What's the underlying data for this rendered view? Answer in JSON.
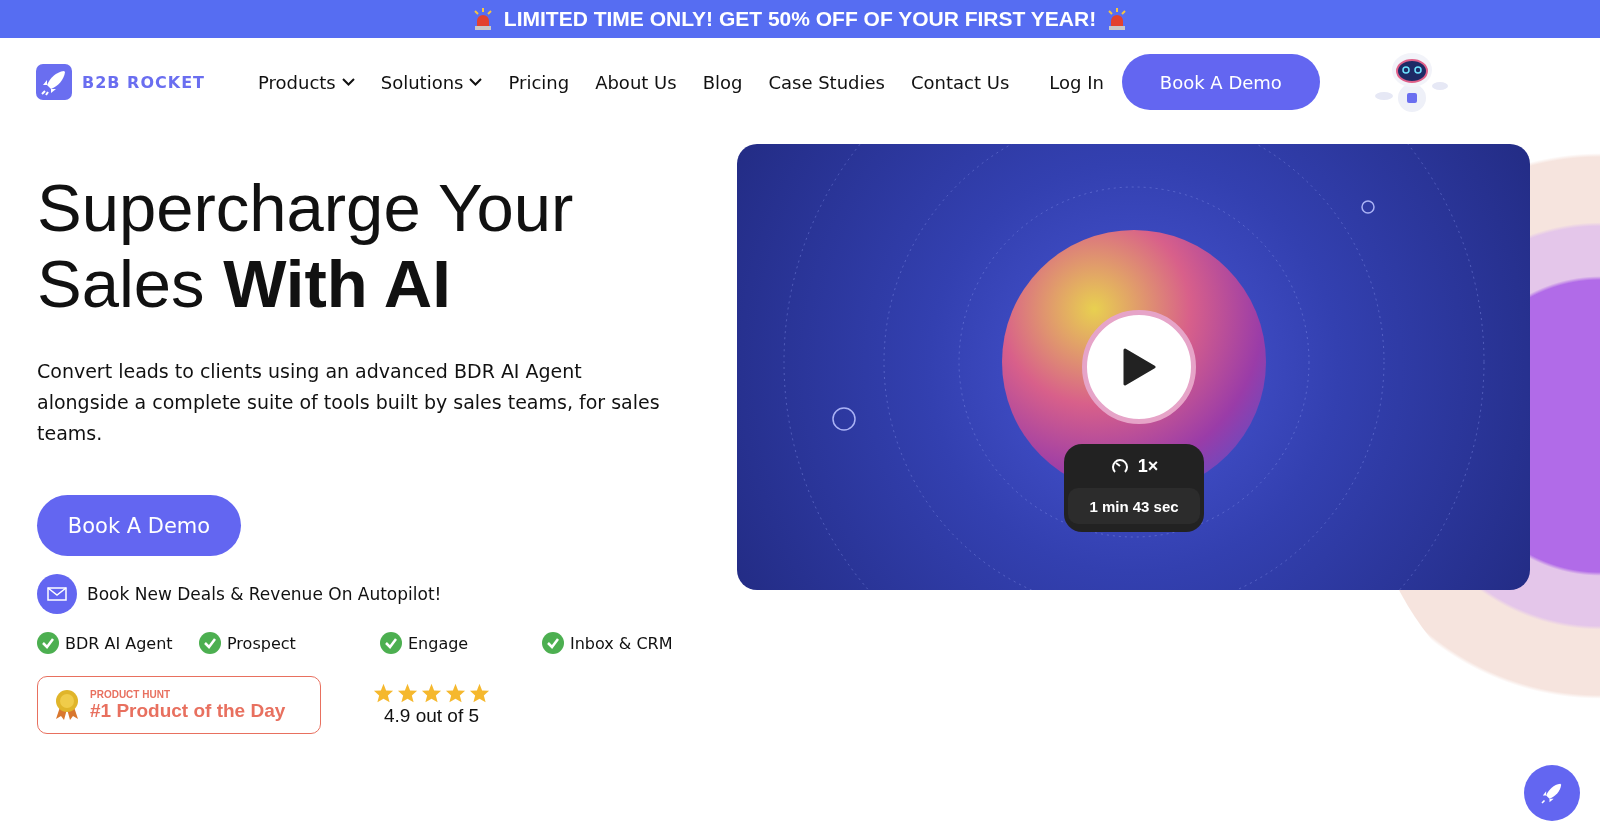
{
  "banner": {
    "text": "LIMITED TIME ONLY! GET 50% OFF OF YOUR FIRST YEAR!"
  },
  "nav": {
    "logo": "B2B ROCKET",
    "items": [
      {
        "label": "Products",
        "dropdown": true
      },
      {
        "label": "Solutions",
        "dropdown": true
      },
      {
        "label": "Pricing",
        "dropdown": false
      },
      {
        "label": "About Us",
        "dropdown": false
      },
      {
        "label": "Blog",
        "dropdown": false
      },
      {
        "label": "Case Studies",
        "dropdown": false
      },
      {
        "label": "Contact Us",
        "dropdown": false
      }
    ],
    "login": "Log In",
    "cta": "Book A Demo"
  },
  "hero": {
    "title": "Supercharge Your Sales **With AI**",
    "subtitle": "Convert leads to clients using an advanced BDR AI Agent alongside a complete suite of tools built by sales teams, for sales teams.",
    "cta": "Book A Demo",
    "tagline": "Book New Deals & Revenue On Autopilot!",
    "features": [
      "BDR AI Agent",
      "Prospect",
      "Engage",
      "Inbox & CRM"
    ],
    "award": {
      "label": "PRODUCT HUNT",
      "title": "#1 Product of the Day"
    },
    "rating": {
      "stars": 5,
      "text": "4.9 out of 5"
    }
  },
  "video": {
    "speed": "1×",
    "duration": "1 min 43 sec"
  }
}
